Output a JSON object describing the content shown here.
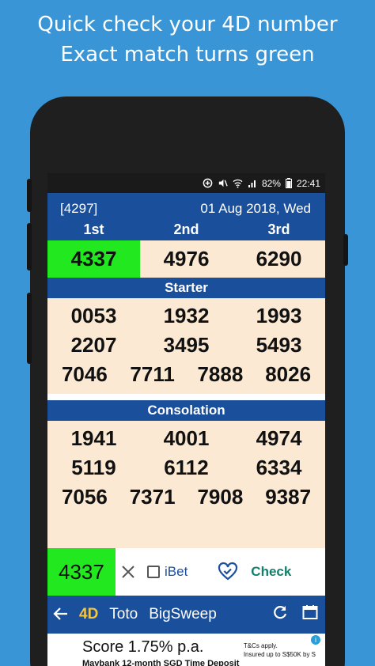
{
  "headline": {
    "line1": "Quick check your 4D number",
    "line2": "Exact match turns green"
  },
  "status_bar": {
    "battery": "82%",
    "time": "22:41"
  },
  "draw": {
    "number": "[4297]",
    "date": "01 Aug 2018, Wed"
  },
  "prizes": {
    "labels": [
      "1st",
      "2nd",
      "3rd"
    ],
    "values": [
      "4337",
      "4976",
      "6290"
    ],
    "highlight_color": "#22e81f"
  },
  "starter": {
    "title": "Starter",
    "rows": [
      [
        "0053",
        "1932",
        "1993"
      ],
      [
        "2207",
        "3495",
        "5493"
      ],
      [
        "7046",
        "7711",
        "7888",
        "8026"
      ]
    ]
  },
  "consolation": {
    "title": "Consolation",
    "rows": [
      [
        "1941",
        "4001",
        "4974"
      ],
      [
        "5119",
        "6112",
        "6334"
      ],
      [
        "7056",
        "7371",
        "7908",
        "9387"
      ]
    ]
  },
  "checker": {
    "input_value": "4337",
    "ibet_label": "iBet",
    "check_label": "Check",
    "icons": [
      "close-icon",
      "heart-check-icon"
    ]
  },
  "nav": {
    "tabs": [
      "4D",
      "Toto",
      "BigSweep"
    ],
    "active": "4D",
    "icons": [
      "back-arrow-icon",
      "refresh-icon",
      "calendar-icon"
    ]
  },
  "ad": {
    "title": "Score 1.75% p.a.",
    "subtitle": "Maybank 12-month SGD Time Deposit",
    "tc_line1": "T&Cs apply.",
    "tc_line2": "Insured up to S$50K by S",
    "info": "i"
  },
  "colors": {
    "background": "#3a95d6",
    "header_blue": "#1a4f9c",
    "cell_bg": "#fbe9d3",
    "check_text": "#127f6d",
    "active_tab": "#f4c542"
  }
}
